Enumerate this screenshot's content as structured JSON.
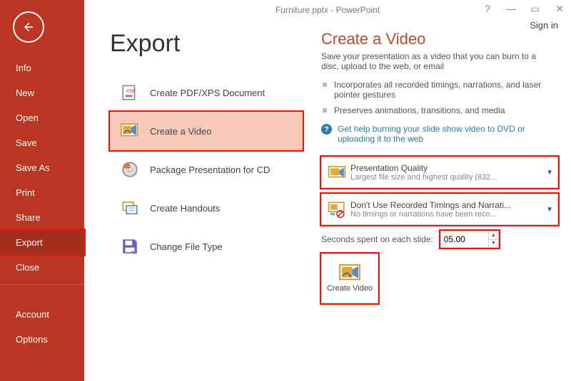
{
  "window": {
    "title": "Furniture.pptx - PowerPoint",
    "signin": "Sign in"
  },
  "sidebar": {
    "items": [
      "Info",
      "New",
      "Open",
      "Save",
      "Save As",
      "Print",
      "Share",
      "Export",
      "Close"
    ],
    "footer": [
      "Account",
      "Options"
    ],
    "selected": 7
  },
  "page_title": "Export",
  "export_options": [
    "Create PDF/XPS Document",
    "Create a Video",
    "Package Presentation for CD",
    "Create Handouts",
    "Change File Type"
  ],
  "export_selected": 1,
  "panel": {
    "heading": "Create a Video",
    "desc": "Save your presentation as a video that you can burn to a disc, upload to the web, or email",
    "bullets": [
      "Incorporates all recorded timings, narrations, and laser pointer gestures",
      "Preserves animations, transitions, and media"
    ],
    "help": "Get help burning your slide show video to DVD or uploading it to the web",
    "quality": {
      "title": "Presentation Quality",
      "sub": "Largest file size and highest quality (832..."
    },
    "timings": {
      "title": "Don't Use Recorded Timings and Narrati...",
      "sub": "No timings or narrations have been reco..."
    },
    "seconds_label": "Seconds spent on each slide:",
    "seconds_value": "05.00",
    "button": "Create Video"
  }
}
